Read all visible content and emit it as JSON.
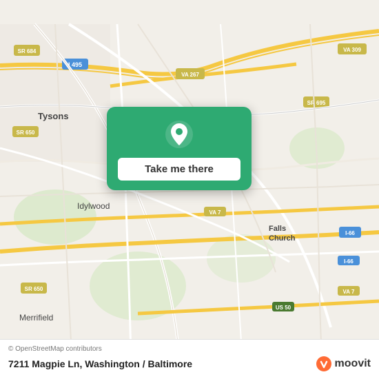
{
  "map": {
    "background_color": "#f2efe9",
    "center_lat": 38.88,
    "center_lon": -77.19
  },
  "card": {
    "button_label": "Take me there",
    "pin_color": "white"
  },
  "bottom_bar": {
    "attribution": "© OpenStreetMap contributors",
    "address": "7211 Magpie Ln, Washington / Baltimore",
    "logo_text": "moovit"
  },
  "labels": {
    "tysons": "Tysons",
    "idylwood": "Idylwood",
    "falls_church": "Falls\nChurch",
    "merrifield": "Merrifield",
    "i495": "I 495",
    "sr684": "SR 684",
    "va267": "VA 267",
    "va309": "VA 309",
    "sr695": "SR 695",
    "sr650_left": "SR 650",
    "sr650_bottom": "SR 650",
    "i66_right": "I-66",
    "i66_bottom": "I-66",
    "va7": "VA 7",
    "va7_bottom": "VA 7",
    "us50": "US 50"
  }
}
